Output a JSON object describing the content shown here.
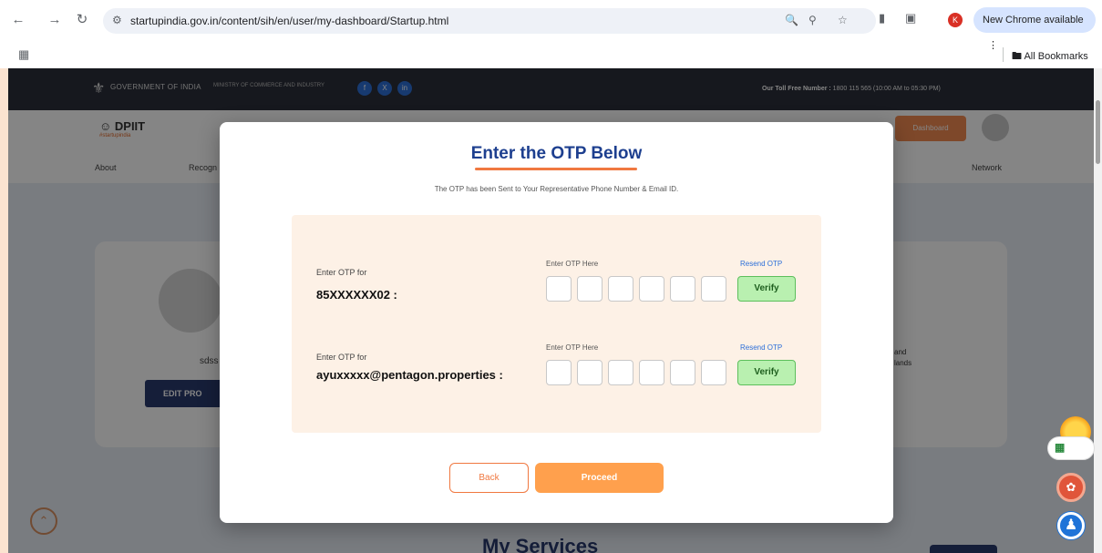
{
  "browser": {
    "url": "startupindia.gov.in/content/sih/en/user/my-dashboard/Startup.html",
    "update_label": "New Chrome available",
    "profile_initial": "K",
    "bookmarks_label": "All Bookmarks"
  },
  "site": {
    "gov_label": "GOVERNMENT OF INDIA",
    "ministry_label": "MINISTRY OF COMMERCE AND INDUSTRY",
    "toll_free_label": "Our Toll Free Number :",
    "toll_free_value": "1800 115 565 (10:00 AM to 05:30 PM)",
    "logo": "DPIIT",
    "logo_sub": "#startupindia",
    "nav": [
      "About",
      "Recogn",
      "Network"
    ],
    "dashboard_label": "Dashboard",
    "profile_name": "sdss",
    "edit_profile_label": "EDIT PRO",
    "side_text": "and\nlands",
    "services_heading": "My Services"
  },
  "modal": {
    "title": "Enter the OTP Below",
    "subtitle": "The OTP has been Sent to Your Representative Phone Number & Email ID.",
    "rows": [
      {
        "label": "Enter OTP for",
        "contact": "85XXXXXX02 :",
        "otp_label": "Enter OTP Here",
        "resend_label": "Resend OTP",
        "verify_label": "Verify"
      },
      {
        "label": "Enter OTP for",
        "contact": "ayuxxxxx@pentagon.properties :",
        "otp_label": "Enter OTP Here",
        "resend_label": "Resend OTP",
        "verify_label": "Verify"
      }
    ],
    "back_label": "Back",
    "proceed_label": "Proceed"
  },
  "colors": {
    "accent": "#f07840",
    "title": "#1d3f8f",
    "verify_bg": "#b9f0b0",
    "proceed_bg": "#ffa04d"
  }
}
